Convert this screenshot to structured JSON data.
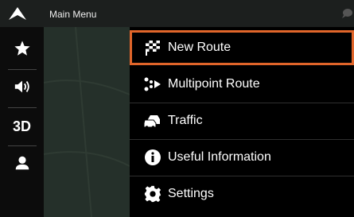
{
  "header": {
    "title": "Main Menu",
    "back_icon": "chevron-up-icon",
    "status_icon": "chat-bubble-icon"
  },
  "sidebar": {
    "items": [
      {
        "name": "favorites",
        "icon": "star-icon"
      },
      {
        "name": "sound",
        "icon": "speaker-icon"
      },
      {
        "name": "3d-view",
        "label": "3D"
      },
      {
        "name": "profile",
        "icon": "user-icon"
      }
    ]
  },
  "menu": {
    "items": [
      {
        "label": "New Route",
        "icon": "checkered-flag-icon",
        "selected": true
      },
      {
        "label": "Multipoint Route",
        "icon": "multipoint-route-icon"
      },
      {
        "label": "Traffic",
        "icon": "traffic-car-icon"
      },
      {
        "label": "Useful Information",
        "icon": "info-icon"
      },
      {
        "label": "Settings",
        "icon": "gear-icon"
      }
    ]
  },
  "colors": {
    "accent": "#e0652a",
    "menu_bg": "#000000",
    "sidebar_bg": "#0c0c0c"
  }
}
